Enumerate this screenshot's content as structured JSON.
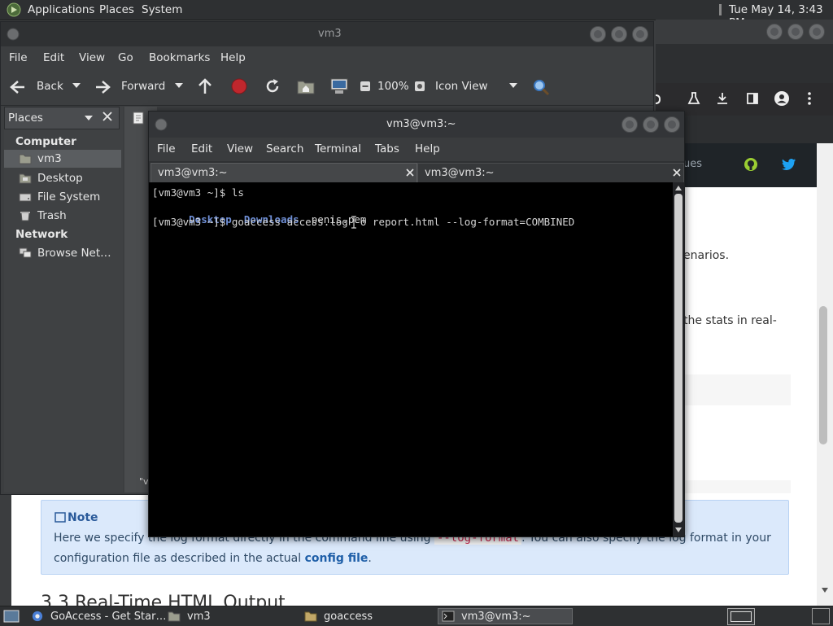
{
  "top_panel": {
    "menus": [
      "Applications",
      "Places",
      "System"
    ],
    "clock": "Tue May 14,  3:43 PM"
  },
  "browser": {
    "partial_text": {
      "issues": "ues",
      "scenarios": "enarios.",
      "stats": "the stats in real-"
    },
    "note": {
      "title": "Note",
      "line1_before": "Here we specify the log format directly in the command line using ",
      "line1_code": "--log-format",
      "line1_after": ". You can also specify the log format in your",
      "line2_before": "configuration file as described in the actual ",
      "line2_link": "config file",
      "line2_after": "."
    },
    "heading_partial": "3.3 Real-Time HTML Output"
  },
  "file_manager": {
    "title": "vm3",
    "menus": [
      "File",
      "Edit",
      "View",
      "Go",
      "Bookmarks",
      "Help"
    ],
    "toolbar": {
      "back": "Back",
      "forward": "Forward",
      "zoom": "100%",
      "view_mode": "Icon View"
    },
    "places_label": "Places",
    "sections": {
      "computer": "Computer",
      "network": "Network"
    },
    "computer_items": [
      "vm3",
      "Desktop",
      "File System",
      "Trash"
    ],
    "network_items": [
      "Browse Net…"
    ],
    "status_partial": "\"v"
  },
  "terminal": {
    "title": "vm3@vm3:~",
    "menus": [
      "File",
      "Edit",
      "View",
      "Search",
      "Terminal",
      "Tabs",
      "Help"
    ],
    "tabs": [
      {
        "label": "vm3@vm3:~",
        "active": true
      },
      {
        "label": "vm3@vm3:~",
        "active": false
      }
    ],
    "lines": {
      "prompt1": "[vm3@vm3 ~]$ ls",
      "ls_dir1": "Desktop",
      "ls_dir2": "Downloads",
      "ls_file": "penis.pem",
      "prompt2": "[vm3@vm3 ~]$ goaccess access.log -o report.html --log-format=COMBINED"
    },
    "colors": {
      "dir": "#6f8fd6",
      "text": "#d6d6d6"
    }
  },
  "taskbar": {
    "items": [
      "GoAccess - Get Star…",
      "vm3",
      "goaccess",
      "vm3@vm3:~"
    ]
  }
}
